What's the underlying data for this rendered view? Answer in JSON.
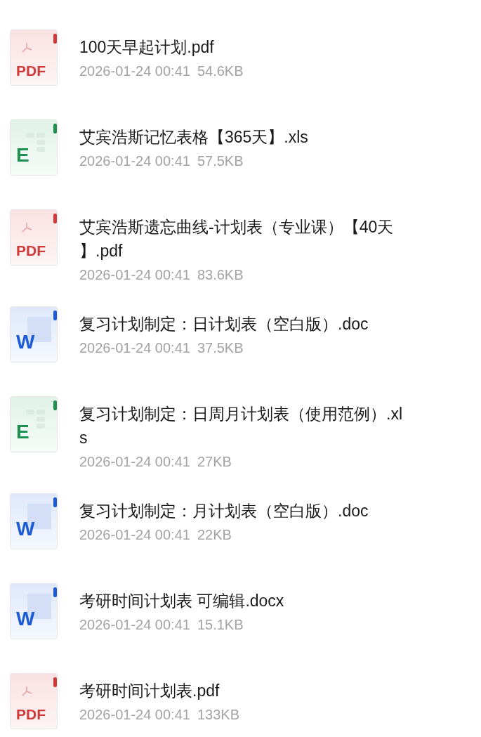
{
  "files": [
    {
      "kind": "pdf",
      "badge": "PDF",
      "title_lines": [
        "100天早起计划.pdf"
      ],
      "date": "2026-01-24 00:41",
      "size": "54.6KB"
    },
    {
      "kind": "xls",
      "badge": "E",
      "title_lines": [
        "艾宾浩斯记忆表格【365天】.xls"
      ],
      "date": "2026-01-24 00:41",
      "size": "57.5KB"
    },
    {
      "kind": "pdf",
      "badge": "PDF",
      "title_lines": [
        "艾宾浩斯遗忘曲线-计划表（专业课）【40天",
        "】.pdf"
      ],
      "date": "2026-01-24 00:41",
      "size": "83.6KB"
    },
    {
      "kind": "doc",
      "badge": "W",
      "title_lines": [
        "复习计划制定：日计划表（空白版）.doc"
      ],
      "date": "2026-01-24 00:41",
      "size": "37.5KB"
    },
    {
      "kind": "xls",
      "badge": "E",
      "title_lines": [
        "复习计划制定：日周月计划表（使用范例）.xl",
        "s"
      ],
      "date": "2026-01-24 00:41",
      "size": "27KB"
    },
    {
      "kind": "doc",
      "badge": "W",
      "title_lines": [
        "复习计划制定：月计划表（空白版）.doc"
      ],
      "date": "2026-01-24 00:41",
      "size": "22KB"
    },
    {
      "kind": "doc",
      "badge": "W",
      "title_lines": [
        "考研时间计划表 可编辑.docx"
      ],
      "date": "2026-01-24 00:41",
      "size": "15.1KB"
    },
    {
      "kind": "pdf",
      "badge": "PDF",
      "title_lines": [
        "考研时间计划表.pdf"
      ],
      "date": "2026-01-24 00:41",
      "size": "133KB"
    }
  ]
}
